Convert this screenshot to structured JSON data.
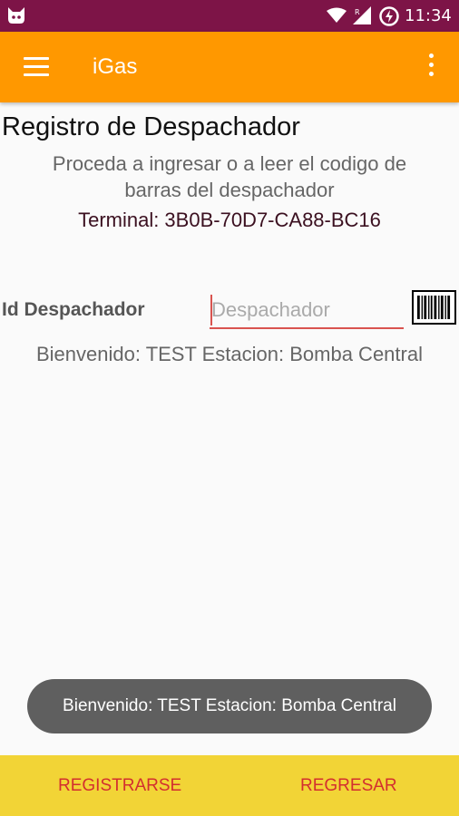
{
  "status_bar": {
    "time": "11:34",
    "icons": [
      "android-cat-icon",
      "wifi-icon",
      "signal-icon",
      "battery-charging-icon"
    ]
  },
  "app_bar": {
    "title": "iGas",
    "menu_icon": "hamburger-menu-icon",
    "overflow_icon": "more-vert-icon",
    "color": "#ff9800"
  },
  "page": {
    "title": "Registro de Despachador",
    "instructions_line1": "Proceda a ingresar o a leer el codigo de",
    "instructions_line2": "barras del despachador",
    "terminal": "Terminal: 3B0B-70D7-CA88-BC16"
  },
  "form": {
    "id_label": "Id Despachador",
    "dispatcher_value": "",
    "dispatcher_placeholder": "Despachador",
    "barcode_icon": "barcode-icon"
  },
  "welcome_text": "Bienvenido: TEST Estacion: Bomba Central",
  "toast": {
    "text": "Bienvenido: TEST Estacion: Bomba Central"
  },
  "bottom_bar": {
    "register_label": "REGISTRARSE",
    "back_label": "REGRESAR",
    "color": "#f2d436",
    "label_color": "#d32f2f"
  },
  "colors": {
    "status_bar": "#7d1447",
    "input_underline": "#d9534f"
  }
}
